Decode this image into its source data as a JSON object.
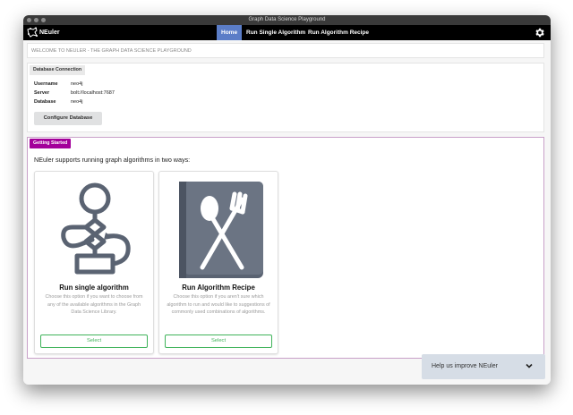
{
  "window": {
    "title": "Graph Data Science Playground"
  },
  "navbar": {
    "brand": "NEuler",
    "items": [
      {
        "label": "Home",
        "active": true
      },
      {
        "label": "Run Single Algorithm",
        "active": false
      },
      {
        "label": "Run Algorithm Recipe",
        "active": false
      }
    ]
  },
  "welcome": {
    "text": "WELCOME TO NEULER - THE GRAPH DATA SCIENCE PLAYGROUND"
  },
  "database": {
    "header": "Database Connection",
    "fields": [
      {
        "key": "Username",
        "value": "neo4j"
      },
      {
        "key": "Server",
        "value": "bolt://localhost:7687"
      },
      {
        "key": "Database",
        "value": "neo4j"
      }
    ],
    "configure_label": "Configure Database"
  },
  "getting_started": {
    "header": "Getting Started",
    "intro": "NEuler supports running graph algorithms in two ways:",
    "cards": [
      {
        "title": "Run single algorithm",
        "desc": "Choose this option if you want to choose from any of the available algorithms in the Graph Data Science Library.",
        "select_label": "Select",
        "icon": "flowchart-icon"
      },
      {
        "title": "Run Algorithm Recipe",
        "desc": "Choose this option if you aren't sure which algorithm to run and would like to suggestions of commonly used combinations of algorithms.",
        "select_label": "Select",
        "icon": "recipe-book-icon"
      }
    ]
  },
  "help": {
    "label": "Help us improve NEuler"
  },
  "colors": {
    "accent": "#5b7dc7",
    "getting_started": "#a3009a",
    "select_green": "#3fb35a",
    "icon_gray": "#5a6372"
  }
}
